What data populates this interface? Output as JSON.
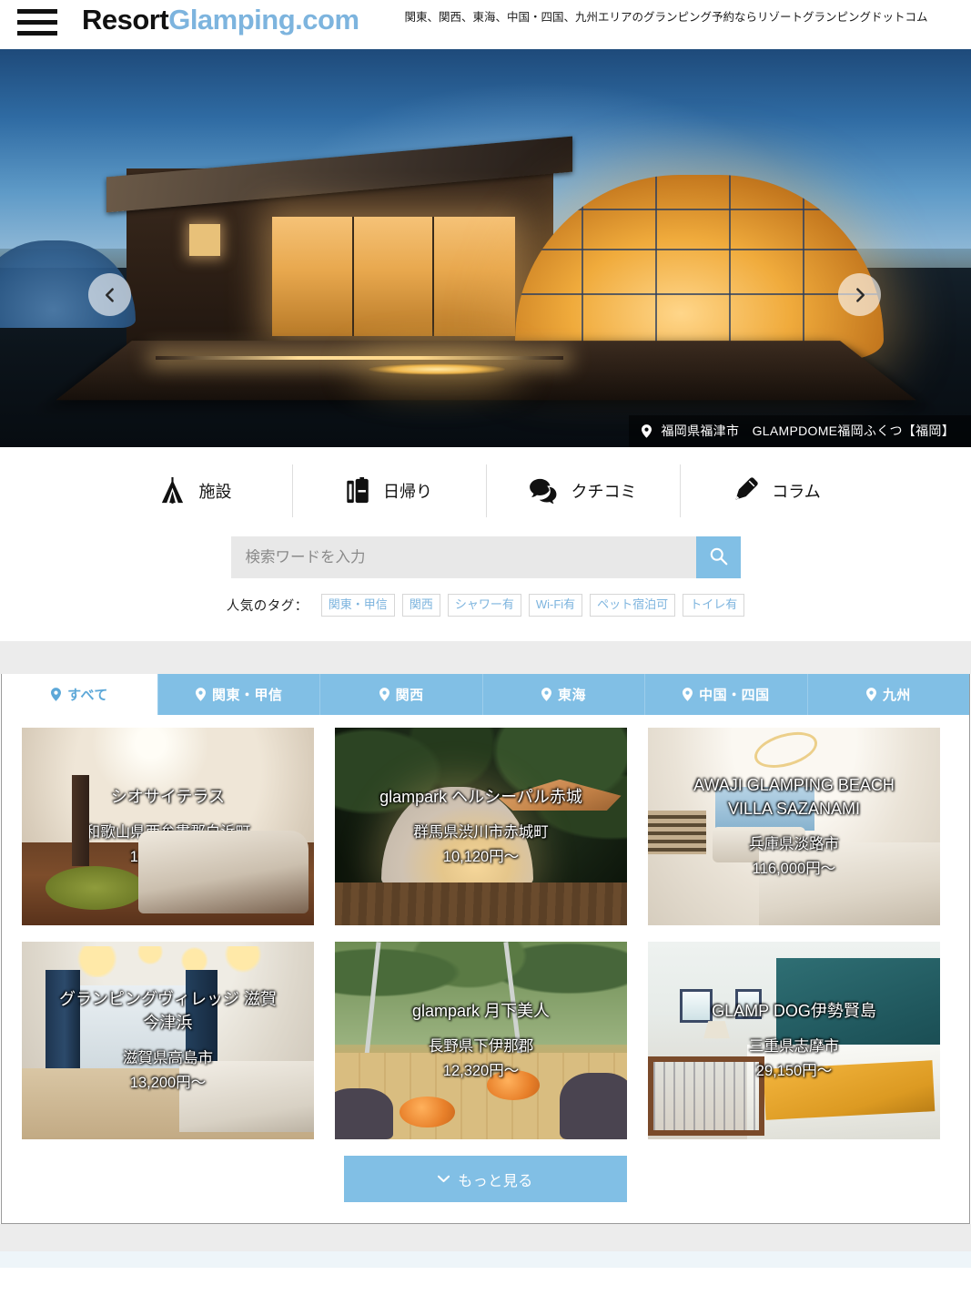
{
  "header": {
    "menu_icon": "hamburger-icon",
    "logo_primary": "Resort",
    "logo_secondary": "Glamping.com",
    "tagline": "関東、関西、東海、中国・四国、九州エリアのグランピング予約ならリゾートグランピングドットコム",
    "logo_accent_color": "#7db4de"
  },
  "hero": {
    "prev_icon": "chevron-left-icon",
    "next_icon": "chevron-right-icon",
    "caption_pin_icon": "map-pin-icon",
    "caption": "福岡県福津市　GLAMPDOME福岡ふくつ【福岡】"
  },
  "quick_nav": [
    {
      "label": "施設",
      "icon": "tent-icon"
    },
    {
      "label": "日帰り",
      "icon": "suitcase-icon"
    },
    {
      "label": "クチコミ",
      "icon": "speech-bubbles-icon"
    },
    {
      "label": "コラム",
      "icon": "pencil-icon"
    }
  ],
  "search": {
    "placeholder": "検索ワードを入力",
    "value": "",
    "button_icon": "search-icon",
    "button_color": "#81bfe5",
    "tags_label": "人気のタグ：",
    "tags": [
      "関東・甲信",
      "関西",
      "シャワー有",
      "Wi-Fi有",
      "ペット宿泊可",
      "トイレ有"
    ]
  },
  "region_tabs": [
    {
      "label": "すべて",
      "icon": "map-pin-icon",
      "active": true
    },
    {
      "label": "関東・甲信",
      "icon": "map-pin-icon",
      "active": false
    },
    {
      "label": "関西",
      "icon": "map-pin-icon",
      "active": false
    },
    {
      "label": "東海",
      "icon": "map-pin-icon",
      "active": false
    },
    {
      "label": "中国・四国",
      "icon": "map-pin-icon",
      "active": false
    },
    {
      "label": "九州",
      "icon": "map-pin-icon",
      "active": false
    }
  ],
  "cards": [
    {
      "title": "シオサイテラス",
      "location": "和歌山県西牟婁郡白浜町",
      "price": "12,320円〜"
    },
    {
      "title": "glampark ヘルシーパル赤城",
      "location": "群馬県渋川市赤城町",
      "price": "10,120円〜"
    },
    {
      "title": "AWAJI GLAMPING BEACH VILLA SAZANAMI",
      "location": "兵庫県淡路市",
      "price": "116,000円〜"
    },
    {
      "title": "グランピングヴィレッジ 滋賀今津浜",
      "location": "滋賀県高島市",
      "price": "13,200円〜"
    },
    {
      "title": "glampark 月下美人",
      "location": "長野県下伊那郡",
      "price": "12,320円〜"
    },
    {
      "title": "GLAMP DOG伊勢賢島",
      "location": "三重県志摩市",
      "price": "29,150円〜"
    }
  ],
  "more_button": {
    "label": "もっと見る",
    "icon": "chevron-down-icon"
  },
  "colors": {
    "accent": "#81bfe5",
    "tab_active_text": "#5da8d8",
    "grey_band": "#ececec"
  }
}
